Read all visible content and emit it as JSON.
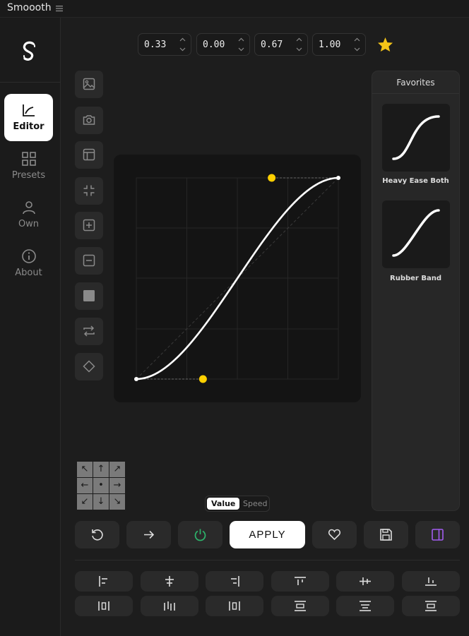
{
  "app": {
    "title": "Smoooth",
    "menu_icon": "hamburger-menu-icon"
  },
  "sidebar": {
    "logo_icon": "svelte-logo-icon",
    "items": [
      {
        "label": "Editor",
        "icon": "chart-icon",
        "active": true
      },
      {
        "label": "Presets",
        "icon": "grid-icon",
        "active": false
      },
      {
        "label": "Own",
        "icon": "user-icon",
        "active": false
      },
      {
        "label": "About",
        "icon": "info-icon",
        "active": false
      }
    ]
  },
  "bezier": {
    "values": [
      "0.33",
      "0.00",
      "0.67",
      "1.00"
    ],
    "favorite_icon": "star-icon",
    "favorite_color": "#f5c518"
  },
  "tools": [
    "image-icon",
    "camera-icon",
    "layout-icon",
    "collapse-icon",
    "zoom-in-icon",
    "zoom-out-icon",
    "square-icon",
    "swap-icon",
    "diamond-icon"
  ],
  "curve": {
    "p1": [
      0.33,
      0.0
    ],
    "p2": [
      0.67,
      1.0
    ],
    "handle_color": "#ffd000"
  },
  "favorites": {
    "title": "Favorites",
    "items": [
      {
        "name": "Heavy Ease Both"
      },
      {
        "name": "Rubber Band"
      }
    ]
  },
  "direction_grid": [
    "↖",
    "↑",
    "↗",
    "←",
    "•",
    "→",
    "↙",
    "↓",
    "↘"
  ],
  "mode_toggle": {
    "options": [
      "Value",
      "Speed"
    ],
    "selected": "Value"
  },
  "actions": {
    "reset_icon": "reset-icon",
    "next_icon": "arrow-right-icon",
    "power_icon": "power-icon",
    "power_color": "#2db36b",
    "apply_label": "APPLY",
    "heart_icon": "heart-icon",
    "save_icon": "save-icon",
    "panel_icon": "panel-toggle-icon",
    "panel_color": "#a25cf0"
  },
  "align_rows": [
    [
      "align-left-icon",
      "align-center-h-icon",
      "align-right-icon",
      "align-top-icon",
      "align-center-v-icon",
      "align-bottom-icon"
    ],
    [
      "distribute-h-left-icon",
      "distribute-h-center-icon",
      "distribute-h-right-icon",
      "distribute-v-top-icon",
      "distribute-v-center-icon",
      "distribute-v-bottom-icon"
    ]
  ]
}
